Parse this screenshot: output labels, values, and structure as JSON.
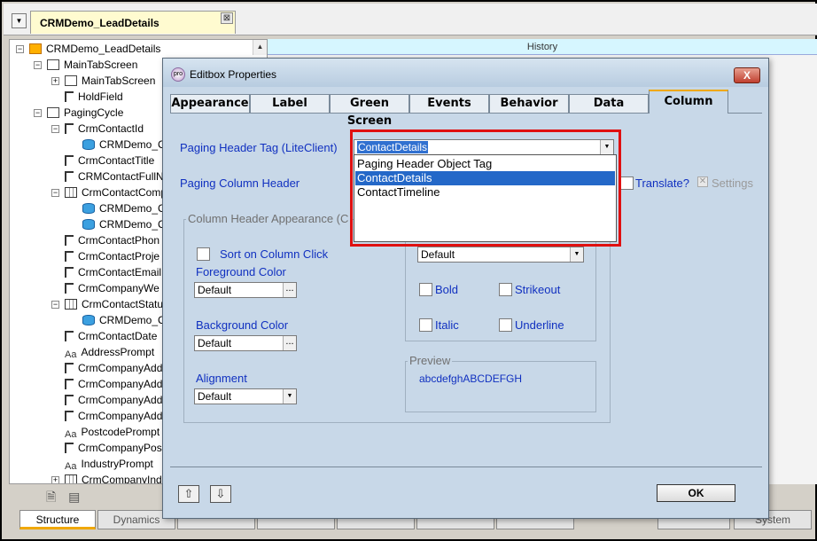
{
  "document_tab": {
    "title": "CRMDemo_LeadDetails",
    "close_glyph": "⊠"
  },
  "tree": {
    "nodes": [
      "CRMDemo_LeadDetails",
      "MainTabScreen",
      "MainTabScreen",
      "HoldField",
      "PagingCycle",
      "CrmContactId",
      "CRMDemo_Co",
      "CrmContactTitle",
      "CRMContactFullN",
      "CrmContactComp",
      "CRMDemo_Co",
      "CRMDemo_Co",
      "CrmContactPhon",
      "CrmContactProje",
      "CrmContactEmail",
      "CrmCompanyWe",
      "CrmContactStatu",
      "CRMDemo_Co",
      "CrmContactDate",
      "AddressPrompt",
      "CrmCompanyAdd",
      "CrmCompanyAdd",
      "CrmCompanyAdd",
      "CrmCompanyAdd",
      "PostcodePrompt",
      "CrmCompanyPos",
      "IndustryPrompt",
      "CrmCompanyInd"
    ],
    "aa_glyph": "Aa"
  },
  "history_label": "History",
  "bottom_tabs": [
    "Structure",
    "Dynamics",
    "System"
  ],
  "dialog": {
    "title": "Editbox Properties",
    "close": "X",
    "tabs": [
      "Appearance",
      "Label",
      "Green Screen",
      "Events",
      "Behavior",
      "Data",
      "Column"
    ],
    "paging_header_tag_label": "Paging Header Tag (LiteClient)",
    "paging_header_tag_value": "ContactDetails",
    "paging_column_header_label": "Paging Column Header",
    "translate_label": "Translate?",
    "settings_label": "Settings",
    "dropdown_options": [
      "Paging Header Object Tag",
      "ContactDetails",
      "ContactTimeline"
    ],
    "column_header_group": "Column Header Appearance (C",
    "sort_on_click": "Sort on Column Click",
    "foreground_color_label": "Foreground Color",
    "foreground_color_value": "Default",
    "background_color_label": "Background Color",
    "background_color_value": "Default",
    "alignment_label": "Alignment",
    "alignment_value": "Default",
    "font_value": "Default",
    "bold": "Bold",
    "strikeout": "Strikeout",
    "italic": "Italic",
    "underline": "Underline",
    "preview_label": "Preview",
    "preview_text": "abcdefghABCDEFGH",
    "ok": "OK",
    "up_glyph": "⇧",
    "down_glyph": "⇩",
    "dots": "...",
    "check_glyph": "✕"
  }
}
